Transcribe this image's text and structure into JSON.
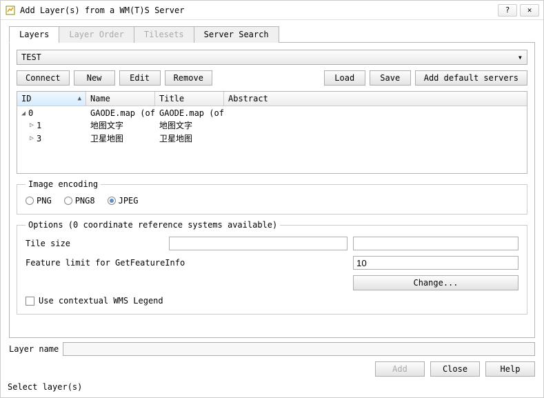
{
  "window": {
    "title": "Add Layer(s) from a WM(T)S Server"
  },
  "tabs": {
    "layers": "Layers",
    "order": "Layer Order",
    "tilesets": "Tilesets",
    "search": "Server Search"
  },
  "server": {
    "name": "TEST"
  },
  "buttons": {
    "connect": "Connect",
    "new": "New",
    "edit": "Edit",
    "remove": "Remove",
    "load": "Load",
    "save": "Save",
    "default_servers": "Add default servers",
    "add": "Add",
    "close": "Close",
    "help": "Help",
    "change": "Change..."
  },
  "table": {
    "cols": {
      "id": "ID",
      "name": "Name",
      "title": "Title",
      "abstract": "Abstract"
    },
    "rows": [
      {
        "id": "0",
        "name": "GAODE.map (of…",
        "title": "GAODE.map (of…",
        "expand": "open",
        "indent": 0
      },
      {
        "id": "1",
        "name": "地图文字",
        "title": "地图文字",
        "expand": "closed",
        "indent": 1
      },
      {
        "id": "3",
        "name": "卫星地图",
        "title": "卫星地图",
        "expand": "closed",
        "indent": 1
      }
    ]
  },
  "encoding": {
    "legend": "Image encoding",
    "png": "PNG",
    "png8": "PNG8",
    "jpeg": "JPEG",
    "selected": "jpeg"
  },
  "options": {
    "legend": "Options (0 coordinate reference systems available)",
    "tile_size_label": "Tile size",
    "tile_size_a": "",
    "tile_size_b": "",
    "feature_limit_label": "Feature limit for GetFeatureInfo",
    "feature_limit_value": "10",
    "use_contextual": "Use contextual WMS Legend"
  },
  "layer_name": {
    "label": "Layer name",
    "value": ""
  },
  "status": "Select layer(s)"
}
